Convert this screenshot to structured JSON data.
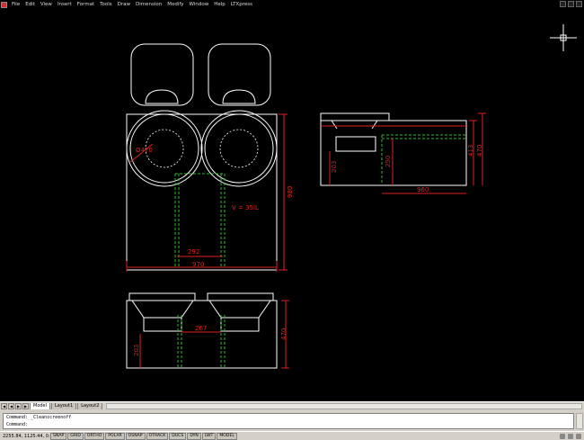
{
  "menubar": {
    "items": [
      "File",
      "Edit",
      "View",
      "Insert",
      "Format",
      "Tools",
      "Draw",
      "Dimension",
      "Modify",
      "Window",
      "Help",
      "LTXpress"
    ]
  },
  "drawing": {
    "dims": {
      "d470": "Ø470",
      "d980": "980",
      "d970": "970",
      "d292": "292",
      "volume": "V = 35lL",
      "d203": "203",
      "d250": "250",
      "d960": "960",
      "d413": "413",
      "d470b": "470",
      "d267": "267",
      "d203b": "203",
      "d470c": "470"
    }
  },
  "tabs": {
    "items": [
      "Model",
      "Layout1",
      "Layout2"
    ],
    "active": "Model"
  },
  "command": {
    "line1": "Command: _Cleanscreenoff",
    "line2": "Command:"
  },
  "status": {
    "coords": "2255.84, 1125.44, 0.00",
    "toggles": [
      "SNAP",
      "GRID",
      "ORTHO",
      "POLAR",
      "OSNAP",
      "OTRACK",
      "DUCS",
      "DYN",
      "LWT",
      "MODEL"
    ]
  }
}
